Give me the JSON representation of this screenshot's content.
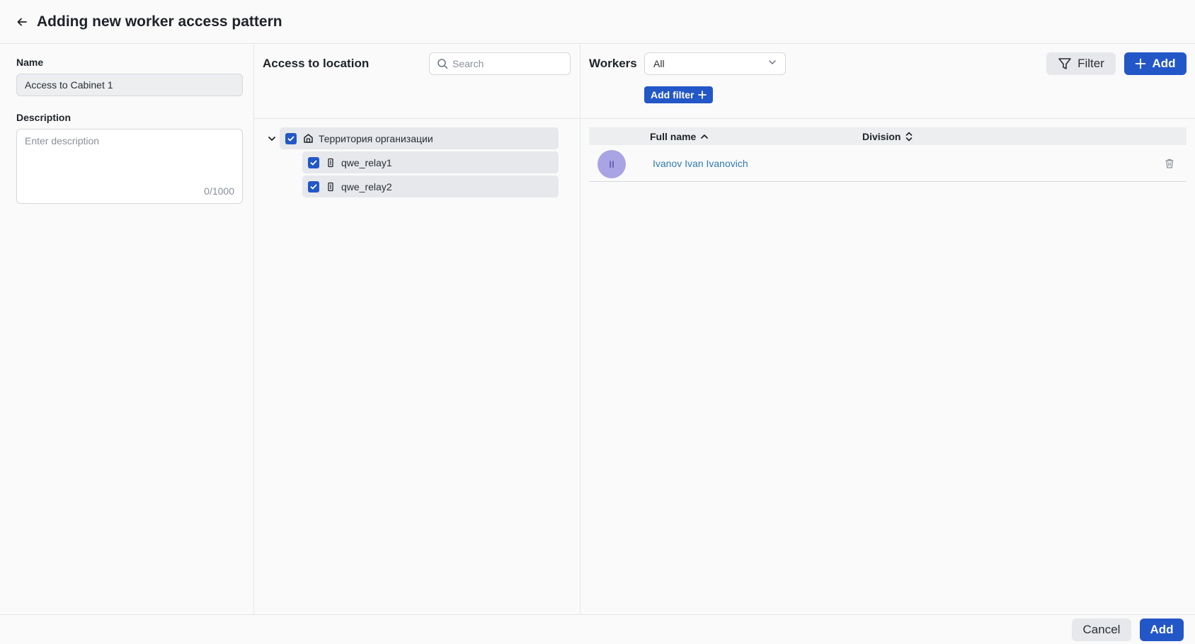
{
  "header": {
    "title": "Adding new worker access pattern",
    "back_icon": "arrow-left-icon"
  },
  "left": {
    "name_label": "Name",
    "name_value": "Access to Cabinet 1",
    "description_label": "Description",
    "description_placeholder": "Enter description",
    "description_counter": "0/1000"
  },
  "location": {
    "title": "Access to location",
    "search_placeholder": "Search",
    "tree": {
      "root": {
        "label": "Территория организации",
        "icon": "building-icon",
        "checked": true,
        "expanded": true
      },
      "children": [
        {
          "label": "qwe_relay1",
          "icon": "door-icon",
          "checked": true
        },
        {
          "label": "qwe_relay2",
          "icon": "door-icon",
          "checked": true
        }
      ]
    }
  },
  "workers": {
    "title": "Workers",
    "select_value": "All",
    "add_filter_label": "Add filter",
    "filter_label": "Filter",
    "add_label": "Add",
    "columns": {
      "full_name": "Full name",
      "division": "Division"
    },
    "rows": [
      {
        "avatar_initials": "II",
        "full_name": "Ivanov Ivan Ivanovich",
        "division": ""
      }
    ]
  },
  "footer": {
    "cancel_label": "Cancel",
    "submit_label": "Add"
  },
  "colors": {
    "primary": "#2357c7",
    "link": "#2f7bb5",
    "avatar": "#a9a4e4"
  }
}
